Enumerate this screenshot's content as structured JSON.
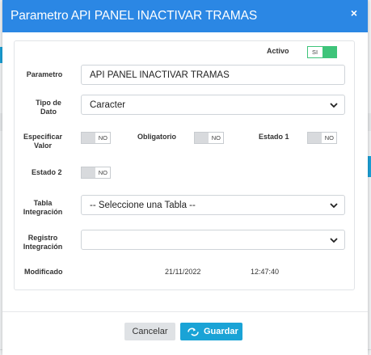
{
  "modal": {
    "title": "Parametro API PANEL INACTIVAR TRAMAS",
    "close_glyph": "×"
  },
  "form": {
    "activo": {
      "label": "Activo",
      "toggle_text": "SI",
      "checked": true
    },
    "parametro": {
      "label": "Parametro",
      "value": "API PANEL INACTIVAR TRAMAS"
    },
    "tipo_dato": {
      "label_line1": "Tipo de",
      "label_line2": "Dato",
      "selected": "Caracter"
    },
    "especificar_valor": {
      "label_line1": "Especificar",
      "label_line2": "Valor",
      "toggle_text": "NO",
      "checked": false
    },
    "obligatorio": {
      "label": "Obligatorio",
      "toggle_text": "NO",
      "checked": false
    },
    "estado1": {
      "label": "Estado 1",
      "toggle_text": "NO",
      "checked": false
    },
    "estado2": {
      "label": "Estado 2",
      "toggle_text": "NO",
      "checked": false
    },
    "tabla_integracion": {
      "label_line1": "Tabla",
      "label_line2": "Integración",
      "selected": "-- Seleccione una Tabla --"
    },
    "registro_integracion": {
      "label_line1": "Registro",
      "label_line2": "Integración",
      "selected": ""
    },
    "modificado": {
      "label": "Modificado",
      "date": "21/11/2022",
      "time": "12:47:40"
    }
  },
  "footer": {
    "cancel_label": "Cancelar",
    "save_label": "Guardar",
    "save_icon": "save-icon"
  },
  "colors": {
    "header": "#2b87e4",
    "toggle_on": "#3ec47a",
    "save_button": "#1aa3d6"
  }
}
